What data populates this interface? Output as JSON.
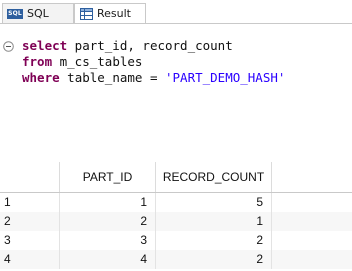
{
  "tabs": [
    {
      "label": "SQL",
      "icon": "sql-icon"
    },
    {
      "label": "Result",
      "icon": "grid-icon"
    }
  ],
  "editor": {
    "lines": [
      {
        "keyword": "select",
        "rest": " part_id, record_count"
      },
      {
        "keyword": "from",
        "rest": " m_cs_tables"
      },
      {
        "keyword": "where",
        "rest": " table_name = ",
        "string": "'PART_DEMO_HASH'"
      }
    ]
  },
  "result": {
    "columns": [
      "",
      "PART_ID",
      "RECORD_COUNT"
    ],
    "rows": [
      {
        "index": "1",
        "part_id": "1",
        "record_count": "5"
      },
      {
        "index": "2",
        "part_id": "2",
        "record_count": "1"
      },
      {
        "index": "3",
        "part_id": "3",
        "record_count": "2"
      },
      {
        "index": "4",
        "part_id": "4",
        "record_count": "2"
      }
    ]
  },
  "colors": {
    "keyword": "#7f0055",
    "string": "#2a00ff",
    "sql_icon_bg": "#2e5f9e"
  }
}
